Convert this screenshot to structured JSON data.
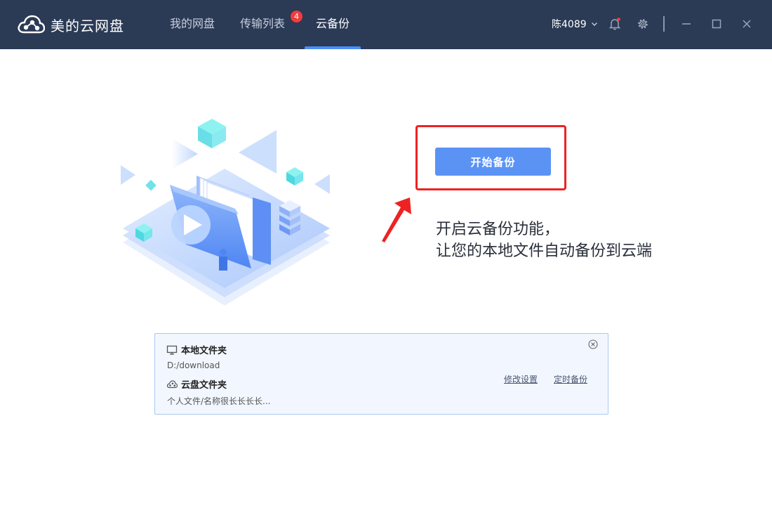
{
  "app": {
    "name": "美的云网盘",
    "logo_icon": "cloud-logo-icon"
  },
  "nav": {
    "tabs": [
      {
        "label": "我的网盘",
        "active": false
      },
      {
        "label": "传输列表",
        "active": false,
        "badge": "4"
      },
      {
        "label": "云备份",
        "active": true
      }
    ]
  },
  "user": {
    "name": "陈4089",
    "icons": [
      "chevron-down-icon",
      "bell-icon",
      "gear-icon",
      "minimize-icon",
      "maximize-icon",
      "close-icon"
    ]
  },
  "main": {
    "start_button": "开始备份",
    "intro_line1": "开启云备份功能，",
    "intro_line2": "让您的本地文件自动备份到云端"
  },
  "card": {
    "local_title": "本地文件夹",
    "local_path": "D:/download",
    "cloud_title": "云盘文件夹",
    "cloud_path": "个人文件/名称很长长长长...",
    "modify_link": "修改设置",
    "schedule_link": "定时备份"
  },
  "colors": {
    "titlebar": "#2b3a55",
    "accent": "#5b93f5",
    "highlight": "#ee2222",
    "badge": "#f03d3d"
  }
}
